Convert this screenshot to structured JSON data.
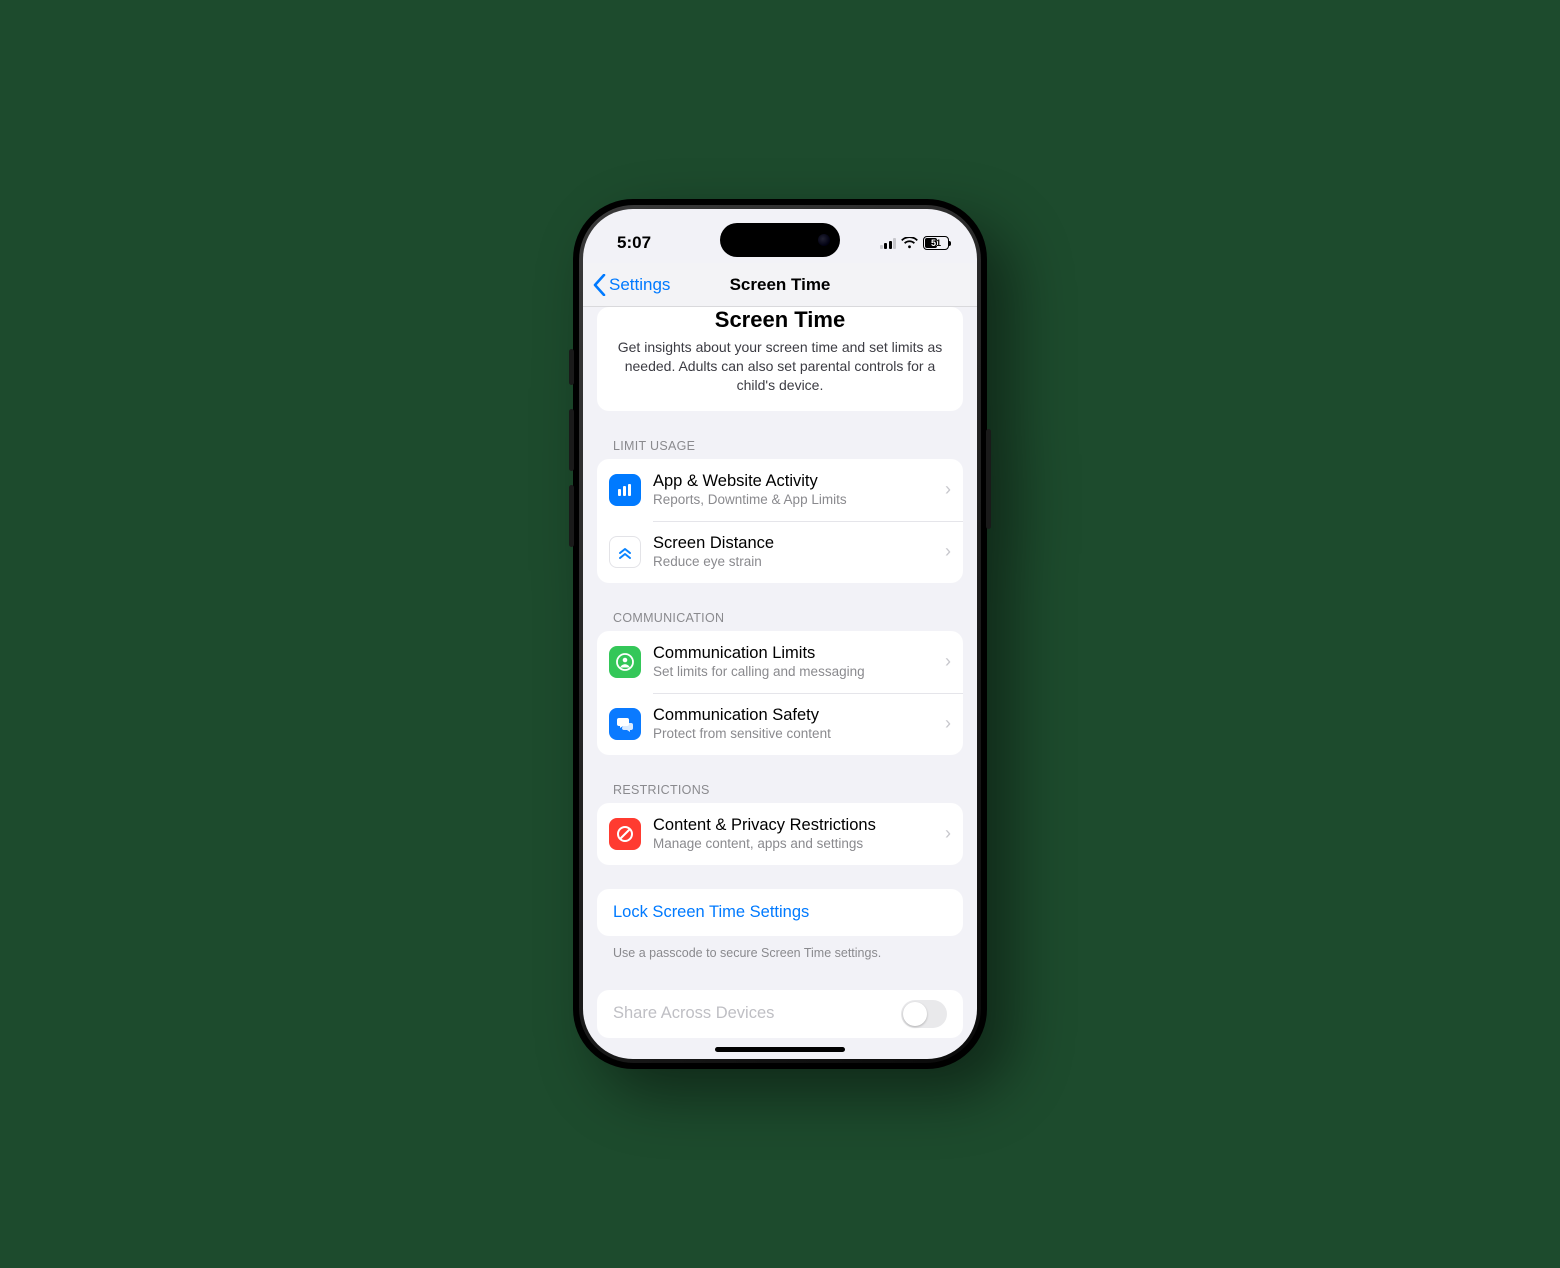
{
  "status": {
    "time": "5:07",
    "battery_pct": "51",
    "signal_bars_on": 2
  },
  "nav": {
    "back_label": "Settings",
    "title": "Screen Time"
  },
  "intro": {
    "heading": "Screen Time",
    "body": "Get insights about your screen time and set limits as needed. Adults can also set parental controls for a child's device."
  },
  "sections": {
    "limit_usage": {
      "header": "LIMIT USAGE",
      "rows": [
        {
          "title": "App & Website Activity",
          "subtitle": "Reports, Downtime & App Limits",
          "icon": "chart-bar-icon",
          "icon_bg": "#007aff"
        },
        {
          "title": "Screen Distance",
          "subtitle": "Reduce eye strain",
          "icon": "chevrons-up-icon",
          "icon_bg": "outline"
        }
      ]
    },
    "communication": {
      "header": "COMMUNICATION",
      "rows": [
        {
          "title": "Communication Limits",
          "subtitle": "Set limits for calling and messaging",
          "icon": "person-circle-icon",
          "icon_bg": "#34c759"
        },
        {
          "title": "Communication Safety",
          "subtitle": "Protect from sensitive content",
          "icon": "speech-bubbles-icon",
          "icon_bg": "#0a7aff"
        }
      ]
    },
    "restrictions": {
      "header": "RESTRICTIONS",
      "rows": [
        {
          "title": "Content & Privacy Restrictions",
          "subtitle": "Manage content, apps and settings",
          "icon": "no-entry-icon",
          "icon_bg": "#ff3b30"
        }
      ]
    }
  },
  "lock": {
    "label": "Lock Screen Time Settings",
    "footnote": "Use a passcode to secure Screen Time settings."
  },
  "peek": {
    "label": "Share Across Devices"
  },
  "colors": {
    "ios_blue": "#007aff",
    "bg": "#f2f2f7"
  }
}
